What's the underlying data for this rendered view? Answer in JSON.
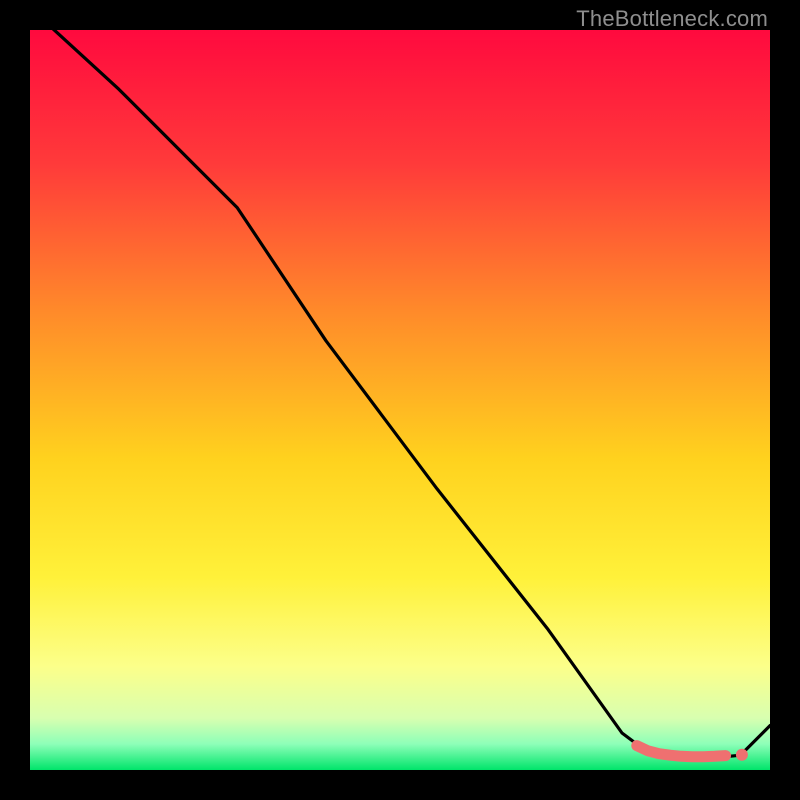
{
  "watermark": "TheBottleneck.com",
  "chart_data": {
    "type": "line",
    "title": "",
    "xlabel": "",
    "ylabel": "",
    "xlim": [
      0,
      100
    ],
    "ylim": [
      0,
      100
    ],
    "grid": false,
    "series": [
      {
        "name": "curve",
        "x": [
          0,
          12,
          22,
          28,
          40,
          55,
          70,
          80,
          84,
          86,
          88,
          90,
          92,
          94,
          96,
          100
        ],
        "y": [
          103,
          92,
          82,
          76,
          58,
          38,
          19,
          5,
          2,
          1.8,
          1.7,
          1.7,
          1.7,
          1.8,
          2,
          6
        ]
      }
    ],
    "markers": {
      "name": "highlight-band",
      "color": "#ef7070",
      "x": [
        82,
        83.5,
        85,
        86.5,
        88,
        89.5,
        91,
        92.5,
        94,
        96.2
      ],
      "y": [
        3.3,
        2.6,
        2.2,
        2.0,
        1.85,
        1.8,
        1.8,
        1.85,
        1.95,
        2.05
      ]
    },
    "colors": {
      "line": "#000000",
      "marker": "#ef7070",
      "gradient_stops": [
        {
          "offset": 0.0,
          "color": "#ff0a3e"
        },
        {
          "offset": 0.18,
          "color": "#ff3a3a"
        },
        {
          "offset": 0.38,
          "color": "#ff8a2a"
        },
        {
          "offset": 0.58,
          "color": "#ffd21e"
        },
        {
          "offset": 0.74,
          "color": "#fff13a"
        },
        {
          "offset": 0.86,
          "color": "#fcff8a"
        },
        {
          "offset": 0.93,
          "color": "#d8ffb0"
        },
        {
          "offset": 0.965,
          "color": "#8dffb8"
        },
        {
          "offset": 1.0,
          "color": "#00e56a"
        }
      ]
    }
  }
}
